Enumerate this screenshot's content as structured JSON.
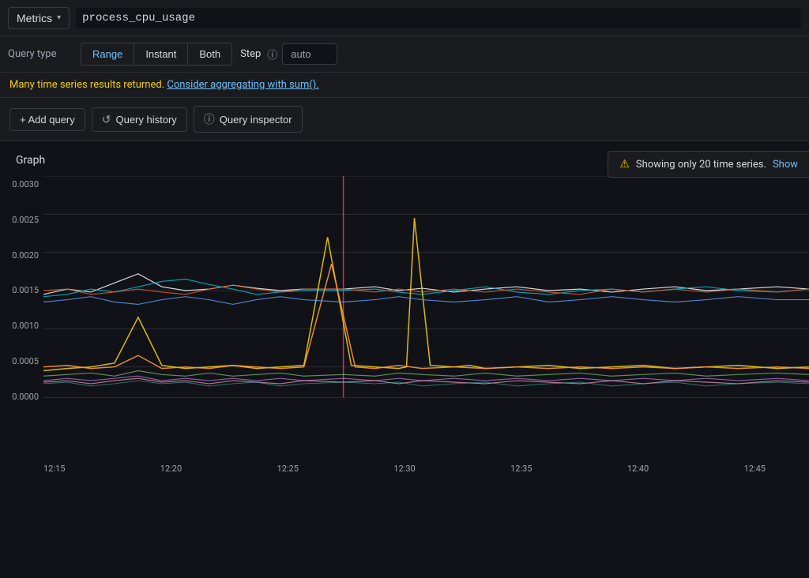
{
  "topbar": {
    "metrics_label": "Metrics",
    "metrics_chevron": "▾",
    "query_value": "process_cpu_usage"
  },
  "query_type": {
    "label": "Query type",
    "buttons": [
      {
        "id": "range",
        "label": "Range",
        "active": true
      },
      {
        "id": "instant",
        "label": "Instant",
        "active": false
      },
      {
        "id": "both",
        "label": "Both",
        "active": false
      }
    ],
    "step_label": "Step",
    "step_value": "auto"
  },
  "warning": {
    "text": "Many time series results returned.",
    "link_text": "Consider aggregating with sum()."
  },
  "actions": {
    "add_query": "+ Add query",
    "query_history": "Query history",
    "query_inspector": "Query inspector"
  },
  "notification": {
    "text": "Showing only 20 time series.",
    "link": "Show"
  },
  "graph": {
    "title": "Graph",
    "y_labels": [
      "0.0030",
      "0.0025",
      "0.0020",
      "0.0015",
      "0.0010",
      "0.0005",
      "0.0000"
    ],
    "x_labels": [
      "12:15",
      "12:20",
      "12:25",
      "12:30",
      "12:35",
      "12:40",
      "12:45"
    ]
  }
}
